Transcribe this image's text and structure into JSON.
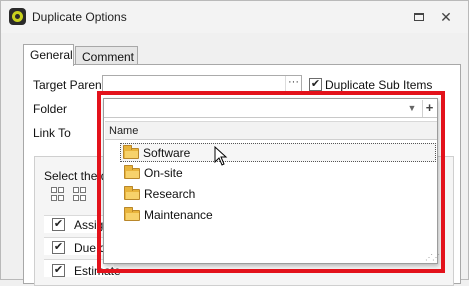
{
  "window": {
    "title": "Duplicate Options"
  },
  "tabs": [
    {
      "label": "General",
      "active": true
    },
    {
      "label": "Comment",
      "active": false
    }
  ],
  "form": {
    "target_parent_label": "Target Parent",
    "target_parent_value": "",
    "browse_button": "···",
    "duplicate_sub_items_label": "Duplicate Sub Items",
    "duplicate_sub_items_checked": true,
    "folder_label": "Folder",
    "link_to_label": "Link To"
  },
  "fields_group": {
    "caption": "Select the d",
    "rows": [
      {
        "label": "Assig",
        "checked": true
      },
      {
        "label": "Due d",
        "checked": true
      },
      {
        "label": "Estimate",
        "checked": true
      }
    ]
  },
  "folder_dropdown": {
    "value": "",
    "arrow": "▼",
    "add": "+",
    "column_header": "Name",
    "items": [
      {
        "label": "Software",
        "selected": true
      },
      {
        "label": "On-site",
        "selected": false
      },
      {
        "label": "Research",
        "selected": false
      },
      {
        "label": "Maintenance",
        "selected": false
      }
    ]
  },
  "colors": {
    "highlight": "#e3121b",
    "folder": "#e8b43c"
  }
}
